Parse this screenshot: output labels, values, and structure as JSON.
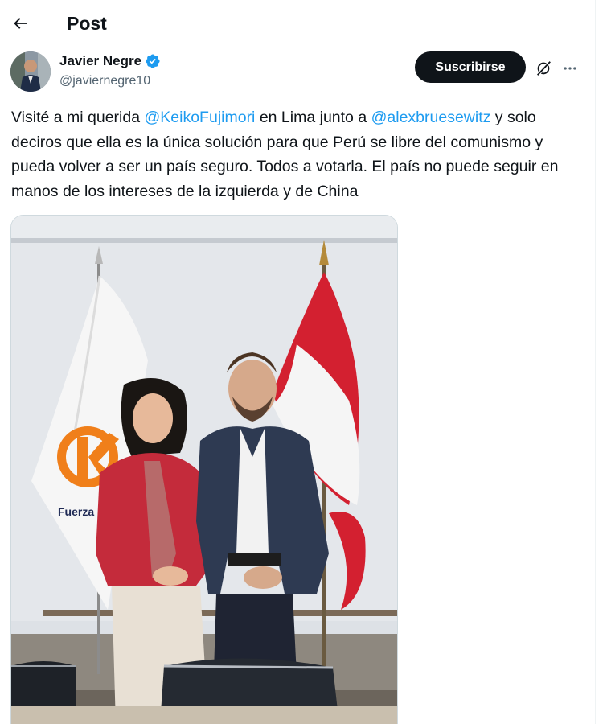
{
  "header": {
    "title": "Post",
    "back_icon": "arrow-left-icon"
  },
  "author": {
    "display_name": "Javier Negre",
    "handle": "@javiernegre10",
    "verified": true,
    "verified_color": "#1d9bf0",
    "subscribe_label": "Suscribirse",
    "grok_icon": "grok-icon",
    "more_icon": "more-horizontal-icon"
  },
  "tweet": {
    "text_1": "Visité a mi querida ",
    "mention_1": "@KeikoFujimori",
    "text_2": " en Lima junto a ",
    "mention_2": "@alexbruesewitz",
    "text_3": " y solo deciros que ella es la única solución para que Perú se libre del comunismo y pueda volver a ser un país seguro. Todos a votarla. El país no puede seguir en manos de los intereses de la izquierda y de China"
  },
  "media": {
    "flag_logo_text": "Fuerza"
  },
  "colors": {
    "text": "#0f1419",
    "secondary": "#536471",
    "link": "#1d9bf0",
    "button_bg": "#0f1419"
  }
}
